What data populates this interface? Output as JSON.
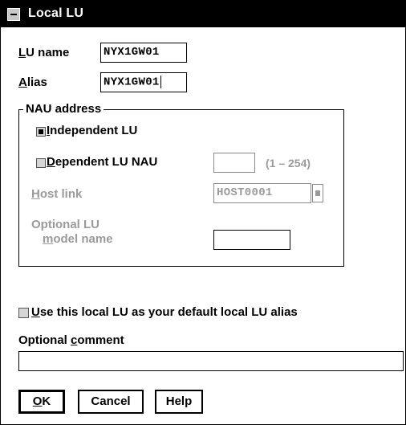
{
  "window": {
    "title": "Local LU",
    "sysmenu_icon": "system-menu-icon"
  },
  "lu_name": {
    "label_accel": "L",
    "label_rest": "U name",
    "value": "NYX1GW01"
  },
  "alias": {
    "label_accel": "A",
    "label_rest": "lias",
    "value": "NYX1GW01"
  },
  "nau_address": {
    "title": "NAU address",
    "independent": {
      "label_accel": "I",
      "label_rest": "ndependent LU",
      "selected": true
    },
    "dependent": {
      "label_accel": "D",
      "label_rest": "ependent LU NAU",
      "selected": false,
      "value": "",
      "range": "(1 – 254)"
    },
    "host_link": {
      "label_accel": "H",
      "label_rest": "ost link",
      "value": "HOST0001",
      "enabled": false
    },
    "model_name": {
      "label_line1": "Optional LU",
      "label_accel": "m",
      "label_rest": "odel name",
      "value": "",
      "enabled": false
    }
  },
  "default_alias": {
    "label_accel": "U",
    "label_rest": "se this local LU as your default local LU alias",
    "checked": false
  },
  "comment": {
    "label_plain": "Optional ",
    "label_accel": "c",
    "label_rest": "omment",
    "value": ""
  },
  "buttons": {
    "ok": "OK",
    "ok_accel": "O",
    "ok_rest": "K",
    "cancel": "Cancel",
    "help": "Help"
  }
}
